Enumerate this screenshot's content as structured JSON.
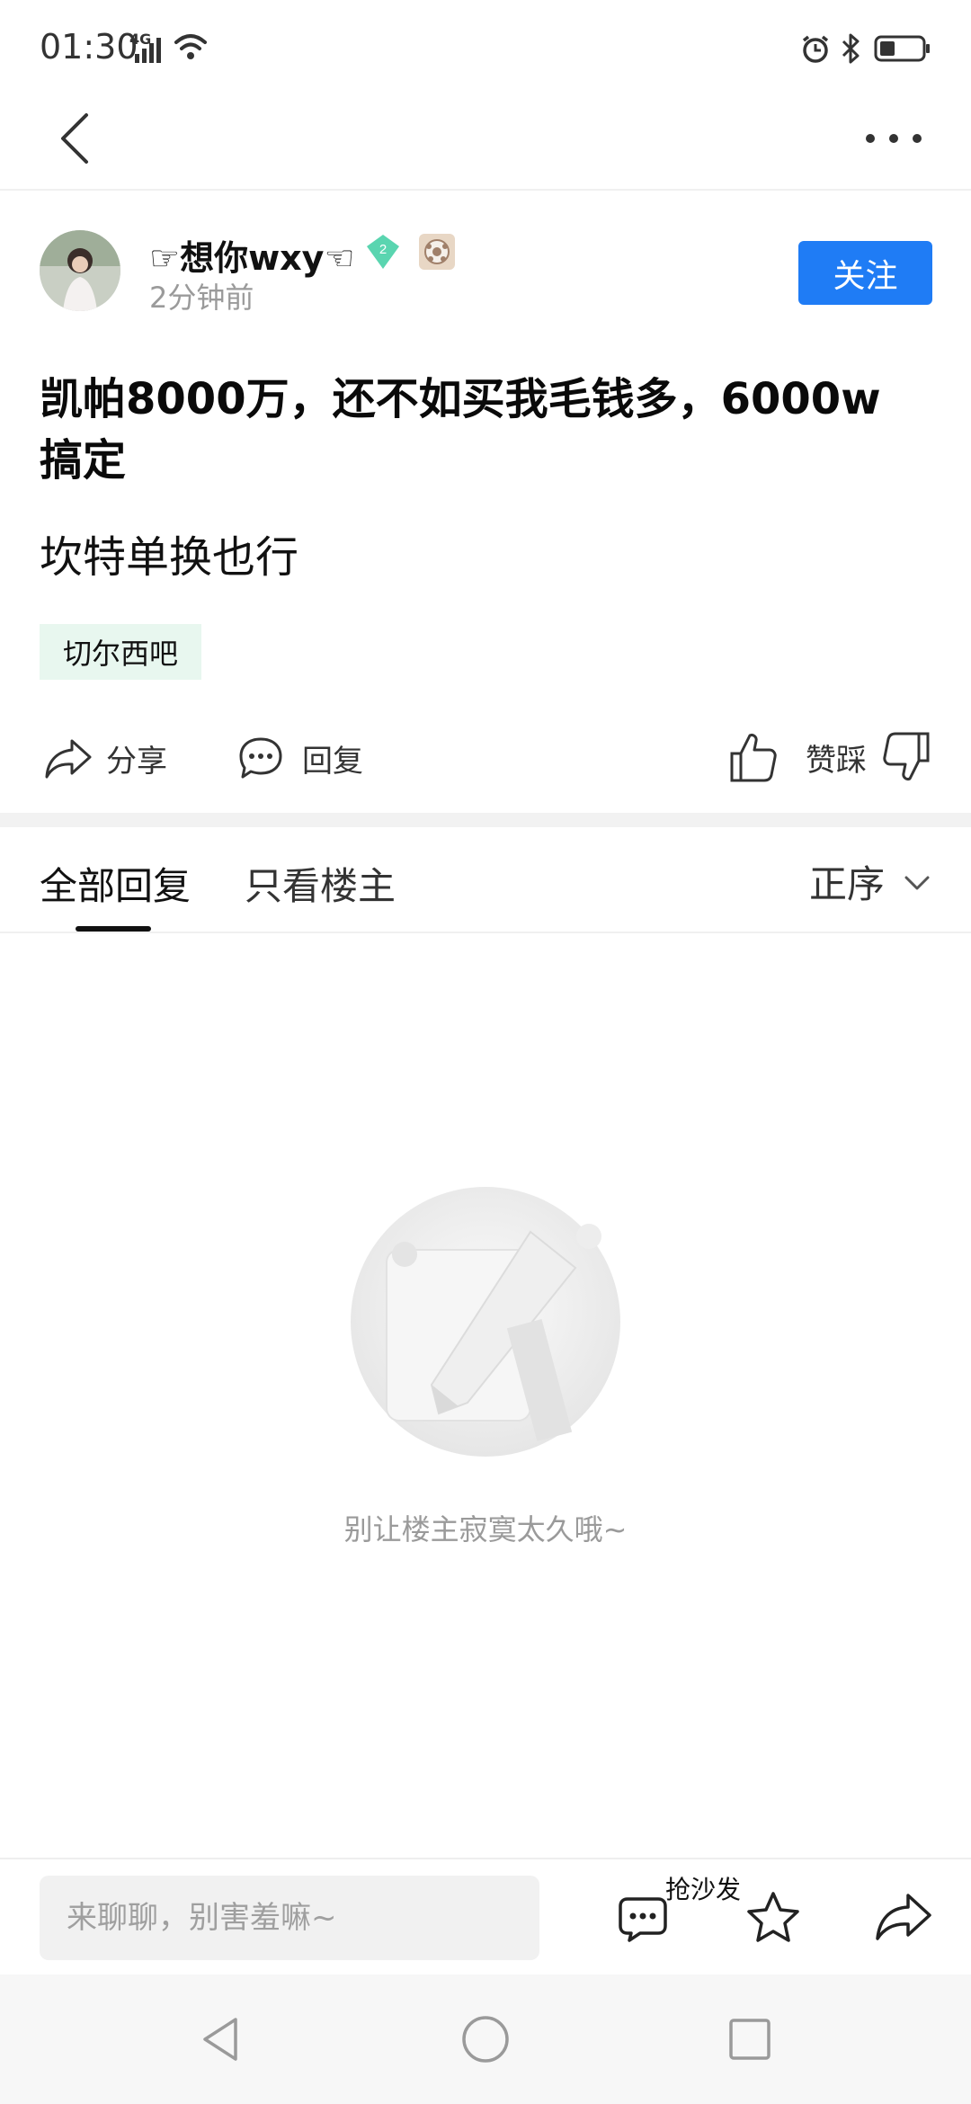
{
  "status_bar": {
    "time": "01:30",
    "network_label": "4G",
    "icons": [
      "signal-icon",
      "wifi-icon",
      "alarm-icon",
      "bluetooth-icon",
      "battery-icon"
    ]
  },
  "nav": {
    "back_icon": "back-arrow-icon",
    "more_icon": "more-dots-icon"
  },
  "post": {
    "author_name": "☞想你wxy☜",
    "level": "2",
    "time_ago": "2分钟前",
    "follow_label": "关注",
    "title": "凯帕8000万，还不如买我毛钱多，6000w搞定",
    "body": "坎特单换也行",
    "forum_tag": "切尔西吧"
  },
  "actions": {
    "share": "分享",
    "reply": "回复",
    "vote": "赞踩"
  },
  "tabs": {
    "all_replies": "全部回复",
    "owner_only": "只看楼主",
    "sort_label": "正序"
  },
  "empty_state": {
    "message": "别让楼主寂寞太久哦~"
  },
  "bottom_bar": {
    "input_placeholder": "来聊聊，别害羞嘛~",
    "sofa_label": "抢沙发"
  },
  "colors": {
    "accent": "#1f7cf5",
    "tag_bg": "#e8f7ef",
    "level_badge": "#5ad5b0",
    "muted_text": "#9a9a9a"
  }
}
